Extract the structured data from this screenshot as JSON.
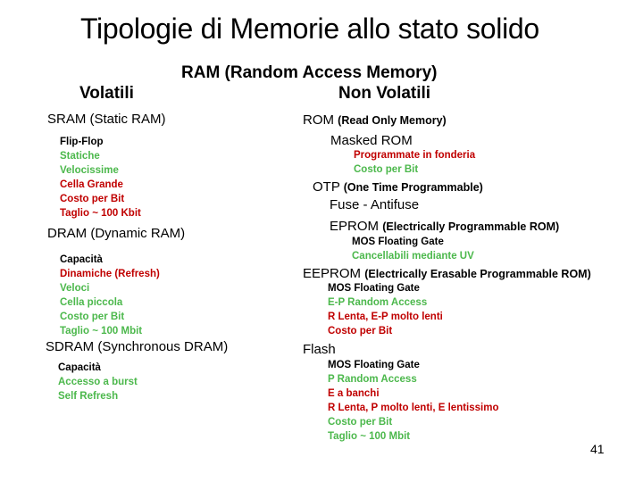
{
  "title": "Tipologie di Memorie allo stato solido",
  "ram_heading": "RAM (Random Access Memory)",
  "volatile_heading": "Volatili",
  "nonvolatile_heading": "Non Volatili",
  "colors": {
    "black": "#000000",
    "green": "#4cb84c",
    "red": "#c00000"
  },
  "volatile": {
    "sram": {
      "label": "SRAM (Static RAM)",
      "items": [
        {
          "text": "Flip-Flop",
          "color": "black"
        },
        {
          "text": "Statiche",
          "color": "green"
        },
        {
          "text": "Velocissime",
          "color": "green"
        },
        {
          "text": "Cella Grande",
          "color": "red"
        },
        {
          "text": "Costo per Bit",
          "color": "red"
        },
        {
          "text": "Taglio ~ 100 Kbit",
          "color": "red"
        }
      ]
    },
    "dram": {
      "label": "DRAM (Dynamic RAM)",
      "items": [
        {
          "text": "Capacità",
          "color": "black"
        },
        {
          "text": "Dinamiche (Refresh)",
          "color": "red"
        },
        {
          "text": "Veloci",
          "color": "green"
        },
        {
          "text": "Cella piccola",
          "color": "green"
        },
        {
          "text": "Costo per Bit",
          "color": "green"
        },
        {
          "text": "Taglio ~ 100 Mbit",
          "color": "green"
        }
      ]
    },
    "sdram": {
      "label": "SDRAM (Synchronous DRAM)",
      "items": [
        {
          "text": "Capacità",
          "color": "black"
        },
        {
          "text": "Accesso a burst",
          "color": "green"
        },
        {
          "text": "Self Refresh",
          "color": "green"
        }
      ]
    }
  },
  "nonvolatile": {
    "rom": {
      "label": "ROM",
      "sub": "(Read Only Memory)"
    },
    "masked_rom": {
      "label": "Masked ROM",
      "items": [
        {
          "text": "Programmate in fonderia",
          "color": "red"
        },
        {
          "text": "Costo per Bit",
          "color": "green"
        }
      ]
    },
    "otp": {
      "label": "OTP",
      "sub": "(One Time Programmable)"
    },
    "fuse": {
      "label": "Fuse - Antifuse"
    },
    "eprom": {
      "label": "EPROM",
      "sub": "(Electrically Programmable ROM)",
      "items": [
        {
          "text": "MOS Floating Gate",
          "color": "black"
        },
        {
          "text": "Cancellabili mediante UV",
          "color": "green"
        }
      ]
    },
    "eeprom": {
      "label": "EEPROM",
      "sub": "(Electrically Erasable Programmable ROM)",
      "items": [
        {
          "text": "MOS Floating Gate",
          "color": "black"
        },
        {
          "text": "E-P Random Access",
          "color": "green"
        },
        {
          "text": "R Lenta, E-P molto lenti",
          "color": "red"
        },
        {
          "text": "Costo per Bit",
          "color": "red"
        }
      ]
    },
    "flash": {
      "label": "Flash",
      "items": [
        {
          "text": "MOS Floating Gate",
          "color": "black"
        },
        {
          "text": "P Random Access",
          "color": "green"
        },
        {
          "text": "E a banchi",
          "color": "red"
        },
        {
          "text": "R Lenta, P molto lenti, E lentissimo",
          "color": "red"
        },
        {
          "text": "Costo per Bit",
          "color": "green"
        },
        {
          "text": "Taglio ~ 100 Mbit",
          "color": "green"
        }
      ]
    }
  },
  "page_number": "41"
}
